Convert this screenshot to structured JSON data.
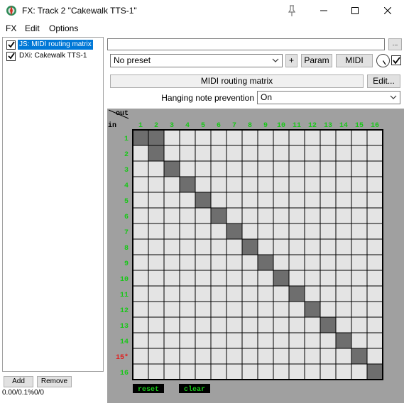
{
  "window": {
    "title": "FX: Track 2 \"Cakewalk TTS-1\"",
    "icon": "reaper-logo-icon"
  },
  "menubar": {
    "items": [
      "FX",
      "Edit",
      "Options"
    ]
  },
  "fx_chain": {
    "items": [
      {
        "label": "JS: MIDI routing matrix",
        "checked": true,
        "selected": true
      },
      {
        "label": "DXi: Cakewalk TTS-1",
        "checked": true,
        "selected": false
      }
    ],
    "add_label": "Add",
    "remove_label": "Remove",
    "status": "0.00/0.1%0/0"
  },
  "plugin_header": {
    "path_value": "",
    "browse_label": "...",
    "preset_value": "No preset",
    "plus_label": "+",
    "param_label": "Param",
    "midi_label": "MIDI",
    "bypass_checked": true,
    "plugin_name": "MIDI routing matrix",
    "edit_label": "Edit..."
  },
  "parameter": {
    "label": "Hanging note prevention",
    "value": "On"
  },
  "matrix": {
    "out_label": "out",
    "in_label": "in",
    "channels": [
      "1",
      "2",
      "3",
      "4",
      "5",
      "6",
      "7",
      "8",
      "9",
      "10",
      "11",
      "12",
      "13",
      "14",
      "15",
      "16"
    ],
    "marked_input_label": "15*",
    "marked_input_index": 14,
    "routes": [
      [
        0,
        0
      ],
      [
        0,
        1
      ],
      [
        1,
        1
      ],
      [
        2,
        2
      ],
      [
        3,
        3
      ],
      [
        4,
        4
      ],
      [
        5,
        5
      ],
      [
        6,
        6
      ],
      [
        7,
        7
      ],
      [
        8,
        8
      ],
      [
        9,
        9
      ],
      [
        10,
        10
      ],
      [
        11,
        11
      ],
      [
        12,
        12
      ],
      [
        13,
        13
      ],
      [
        14,
        14
      ],
      [
        15,
        15
      ]
    ],
    "reset_label": "reset",
    "clear_label": "clear",
    "colors": {
      "background": "#a0a0a0",
      "cell_off": "#e4e4e4",
      "cell_on": "#6e6e6e",
      "channel_text": "#19c719",
      "marked_text": "#e02020",
      "button_bg": "#000000",
      "button_text": "#19c719"
    }
  }
}
